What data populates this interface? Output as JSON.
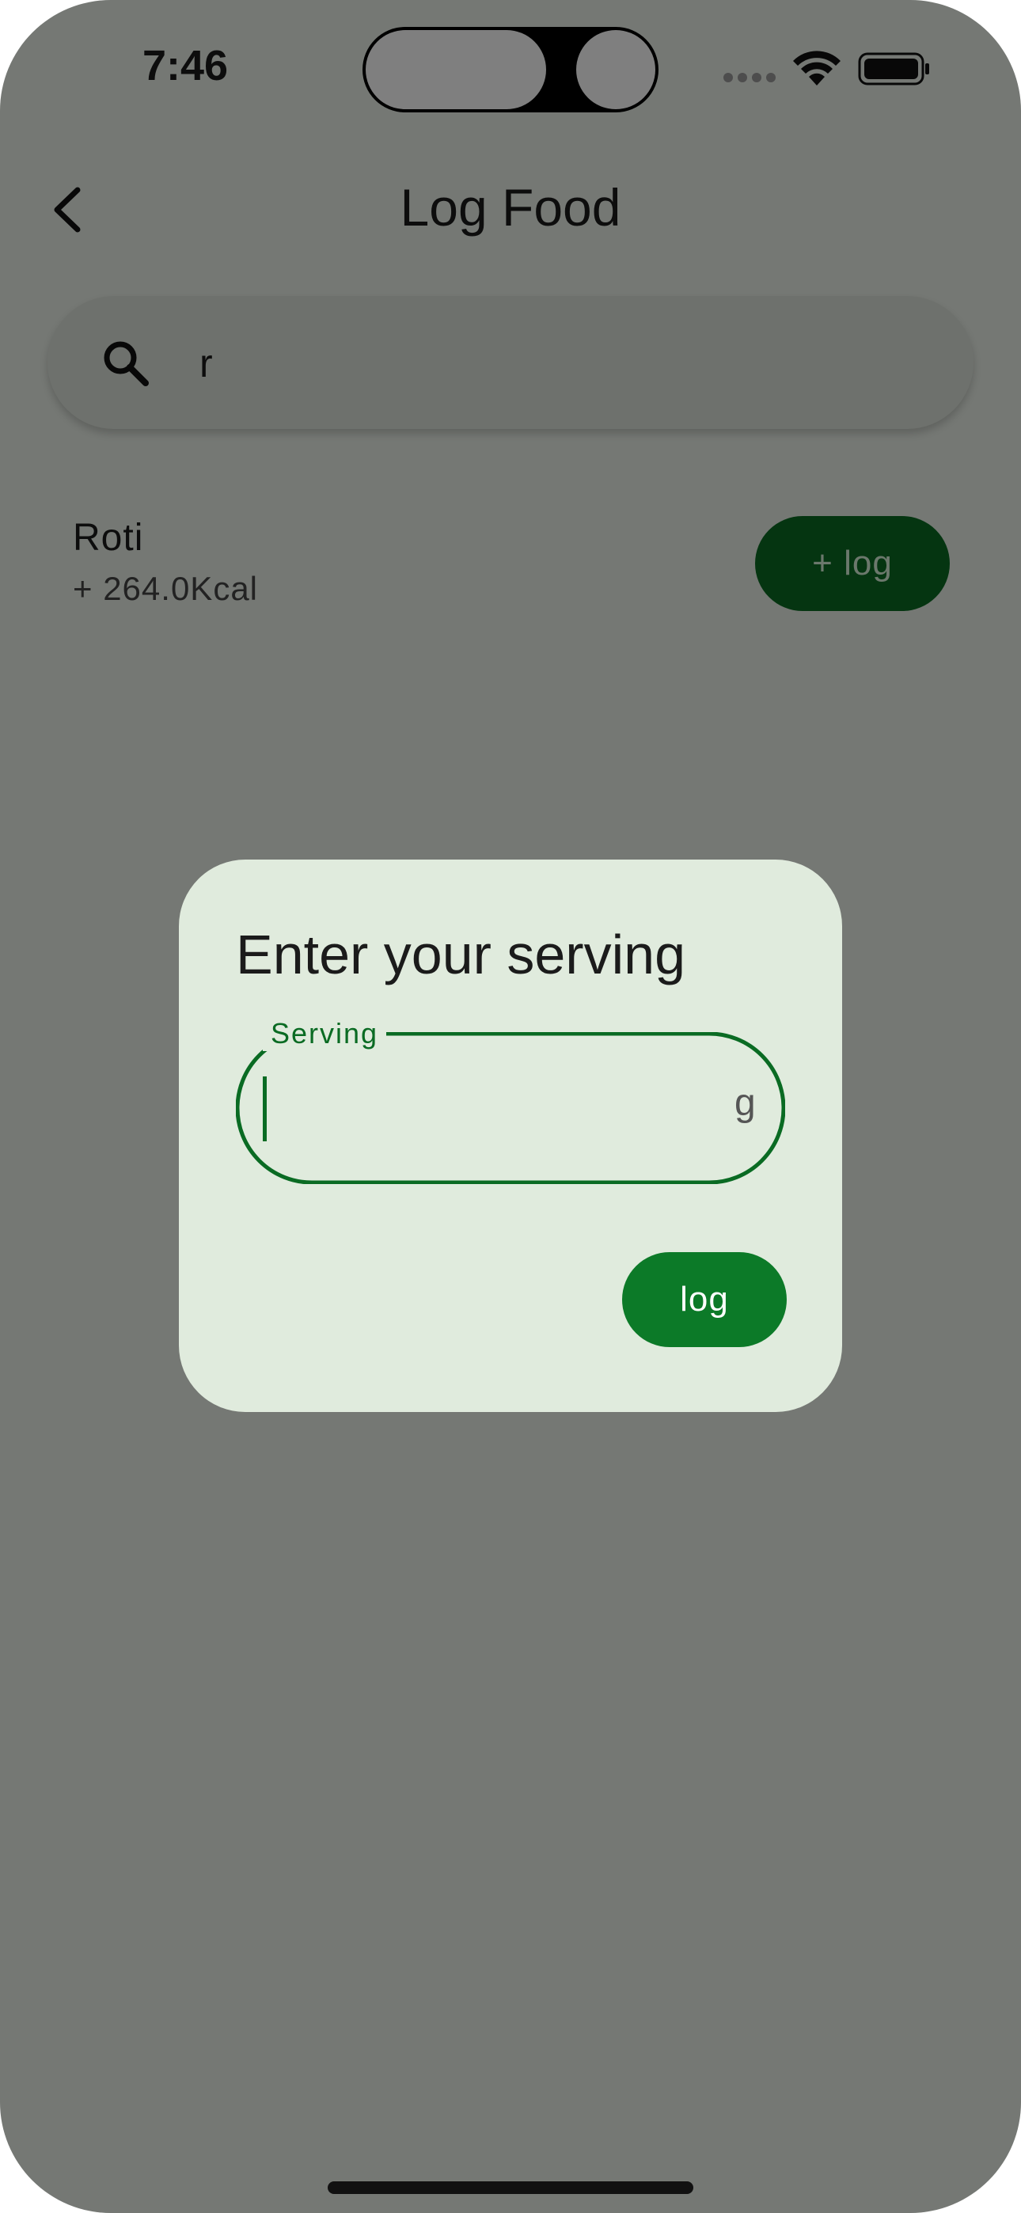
{
  "status_bar": {
    "time": "7:46"
  },
  "app_bar": {
    "title": "Log Food",
    "back_icon": "chevron-left-icon"
  },
  "search": {
    "value": "r",
    "icon": "search-icon"
  },
  "results": [
    {
      "name": "Roti",
      "kcal": "+ 264.0Kcal",
      "button_label": "+ log"
    }
  ],
  "dialog": {
    "title": "Enter your serving",
    "field_label": "Serving",
    "field_value": "",
    "field_suffix": "g",
    "log_label": "log"
  },
  "colors": {
    "accent": "#0c7a28",
    "dialog_bg": "#e0ebdd",
    "scrim": "rgba(0,0,0,0.5)"
  }
}
